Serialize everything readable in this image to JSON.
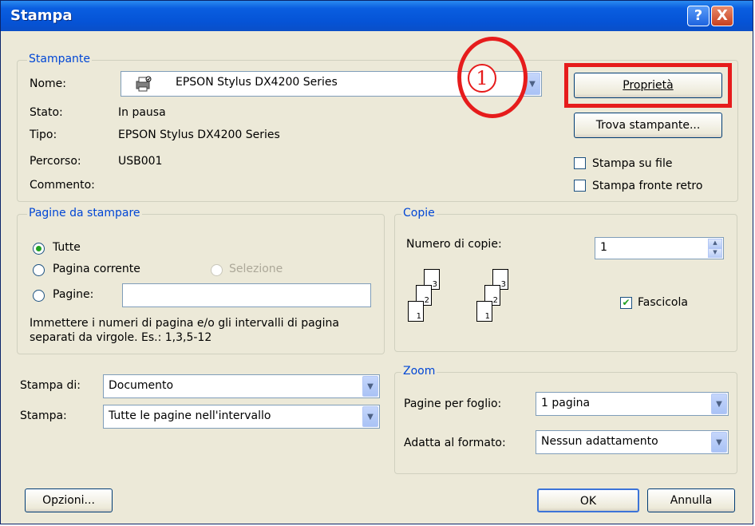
{
  "window": {
    "title": "Stampa",
    "help_button": "?",
    "close_button": "X"
  },
  "printer": {
    "group_label": "Stampante",
    "name_label": "Nome:",
    "name_value": "EPSON Stylus DX4200 Series",
    "status_label": "Stato:",
    "status_value": "In pausa",
    "type_label": "Tipo:",
    "type_value": "EPSON Stylus DX4200 Series",
    "path_label": "Percorso:",
    "path_value": "USB001",
    "comment_label": "Commento:",
    "comment_value": "",
    "properties_button": "Proprietà",
    "find_printer_button": "Trova stampante...",
    "print_to_file_label": "Stampa su file",
    "print_to_file_checked": false,
    "duplex_label": "Stampa fronte retro",
    "duplex_checked": false
  },
  "pages": {
    "group_label": "Pagine da stampare",
    "all_label": "Tutte",
    "all_selected": true,
    "current_page_label": "Pagina corrente",
    "selection_label": "Selezione",
    "pages_label": "Pagine:",
    "pages_value": "",
    "help_text_line1": "Immettere i numeri di pagina e/o gli intervalli di pagina",
    "help_text_line2": "separati da virgole. Es.: 1,3,5-12"
  },
  "copies": {
    "group_label": "Copie",
    "count_label": "Numero di copie:",
    "count_value": "1",
    "collate_label": "Fascicola",
    "collate_checked": true,
    "stack_page_numbers": [
      "3",
      "2",
      "1"
    ]
  },
  "print_options": {
    "print_what_label": "Stampa di:",
    "print_what_value": "Documento",
    "print_label": "Stampa:",
    "print_value": "Tutte le pagine nell'intervallo"
  },
  "zoom": {
    "group_label": "Zoom",
    "pages_per_sheet_label": "Pagine per foglio:",
    "pages_per_sheet_value": "1 pagina",
    "scale_label": "Adatta al formato:",
    "scale_value": "Nessun adattamento"
  },
  "footer": {
    "options_button": "Opzioni...",
    "ok_button": "OK",
    "cancel_button": "Annulla"
  },
  "annotation": {
    "marker_number": "1",
    "accent_color": "#e61c1c"
  }
}
